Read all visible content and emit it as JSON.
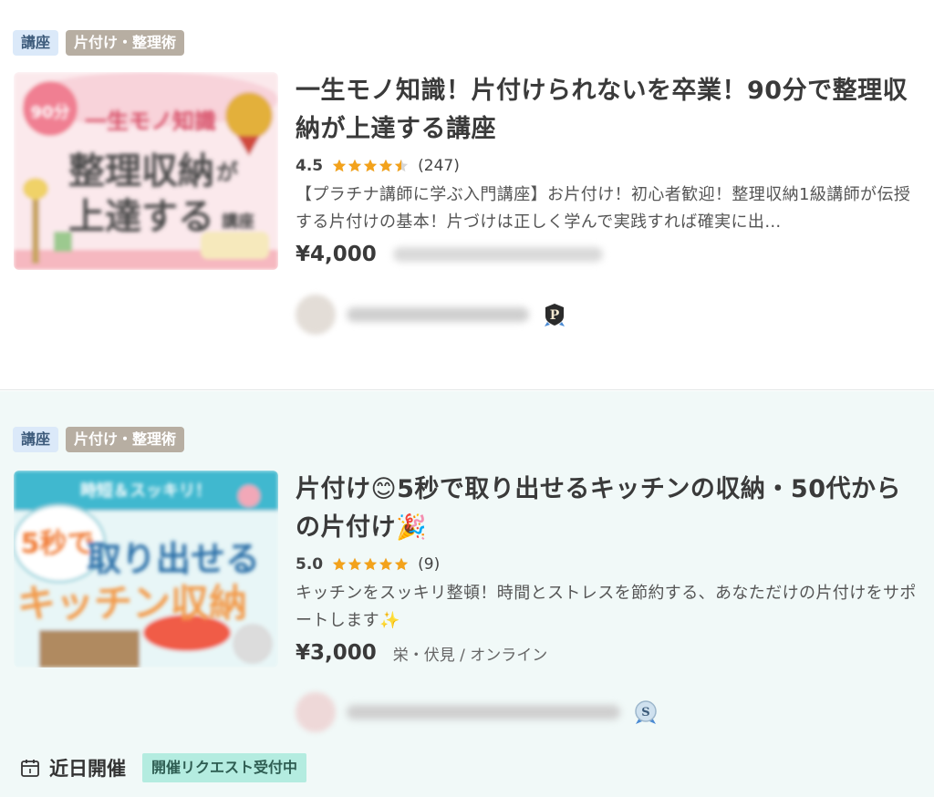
{
  "listings": [
    {
      "type_tag": "講座",
      "category_tag": "片付け・整理術",
      "thumbnail": {
        "badge": "90分",
        "line1": "一生モノ知識",
        "line2a": "整理収納",
        "line2b": "が",
        "line3a": "上達する",
        "line3b": "講座"
      },
      "title": "一生モノ知識！片付けられないを卒業！90分で整理収納が上達する講座",
      "rating_value": "4.5",
      "rating_stars": 4.5,
      "rating_count": "(247)",
      "description": "【プラチナ講師に学ぶ入門講座】お片付け！初心者歓迎！整理収納1級講師が伝授する片付けの基本！片づけは正しく学んで実践すれば確実に出…",
      "price": "¥4,000",
      "teacher_badge_icon": "platinum-badge-icon",
      "teacher_badge_letter": "P"
    },
    {
      "type_tag": "講座",
      "category_tag": "片付け・整理術",
      "thumbnail": {
        "banner": "時短＆スッキリ！",
        "bubble": "5秒で",
        "line1": "取り出せる",
        "line2": "キッチン収納"
      },
      "title": "片付け😊5秒で取り出せるキッチンの収納・50代からの片付け🎉",
      "rating_value": "5.0",
      "rating_stars": 5,
      "rating_count": "(9)",
      "description": "キッチンをスッキリ整頓！時間とストレスを節約する、あなただけの片付けをサポートします✨",
      "price": "¥3,000",
      "location": "栄・伏見 / オンライン",
      "teacher_badge_icon": "silver-badge-icon",
      "teacher_badge_letter": "S",
      "event_label": "近日開催",
      "event_badge": "開催リクエスト受付中"
    }
  ],
  "colors": {
    "star": "#f3a21b",
    "star_empty": "#d6d6d6",
    "type_tag_bg": "#dbe9f9",
    "category_tag_bg": "#b7aea2",
    "card2_bg": "#f1f9f8",
    "event_badge_bg": "#b4ece0"
  }
}
